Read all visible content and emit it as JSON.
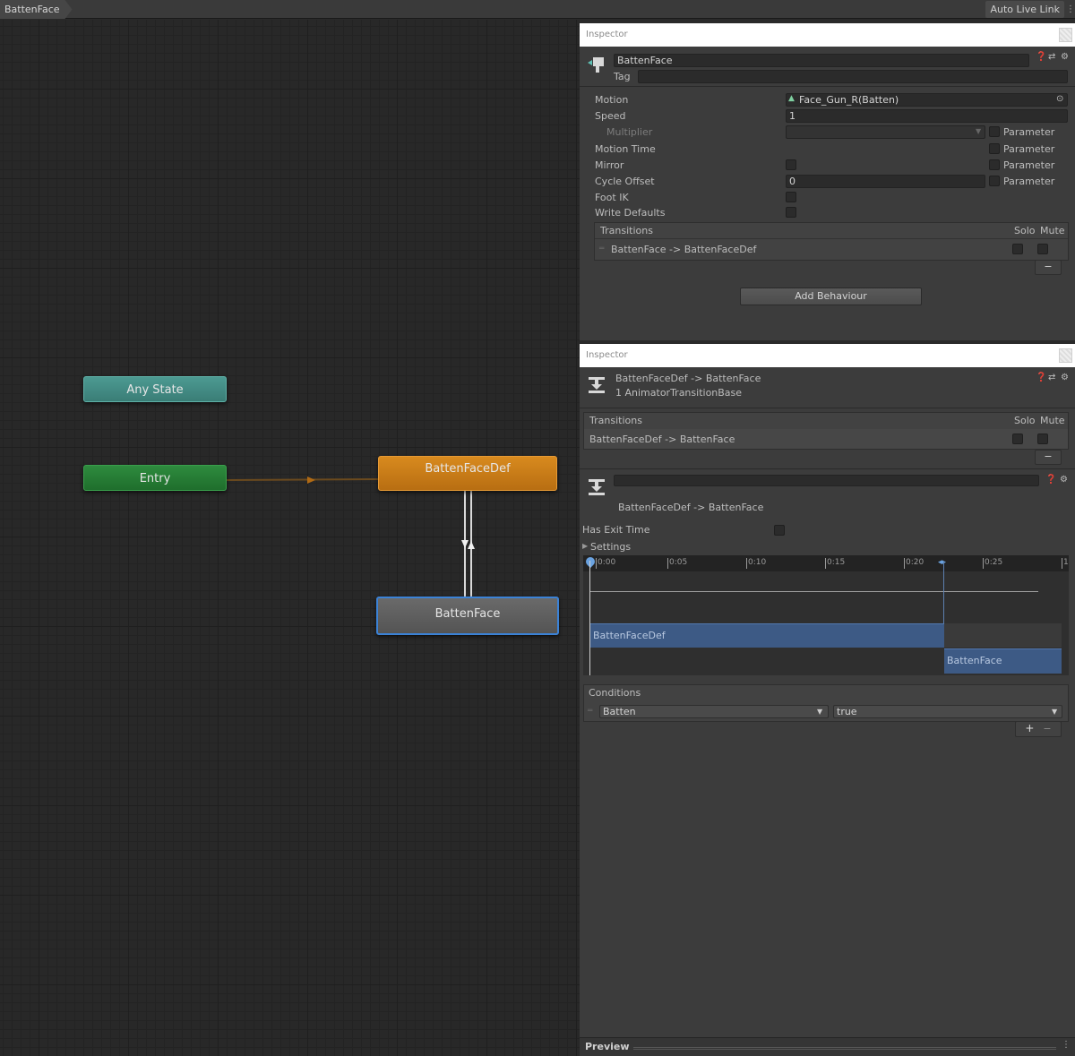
{
  "topbar": {
    "breadcrumb": "BattenFace",
    "auto_live_link": "Auto Live Link"
  },
  "graph": {
    "nodes": {
      "any_state": "Any State",
      "entry": "Entry",
      "batten_face_def": "BattenFaceDef",
      "batten_face": "BattenFace"
    }
  },
  "inspector1": {
    "title": "Inspector",
    "state_name": "BattenFace",
    "tag_label": "Tag",
    "tag_value": "",
    "motion_label": "Motion",
    "motion_value": "Face_Gun_R(Batten)",
    "speed_label": "Speed",
    "speed_value": "1",
    "multiplier_label": "Multiplier",
    "motion_time_label": "Motion Time",
    "mirror_label": "Mirror",
    "cycle_offset_label": "Cycle Offset",
    "cycle_offset_value": "0",
    "foot_ik_label": "Foot IK",
    "write_defaults_label": "Write Defaults",
    "parameter_label": "Parameter",
    "transitions_header": "Transitions",
    "solo_label": "Solo",
    "mute_label": "Mute",
    "transition_row": "BattenFace -> BattenFaceDef",
    "minus": "−",
    "add_behaviour": "Add Behaviour"
  },
  "inspector2": {
    "title": "Inspector",
    "header_title": "BattenFaceDef -> BattenFace",
    "header_subtitle": "1 AnimatorTransitionBase",
    "transitions_header": "Transitions",
    "solo_label": "Solo",
    "mute_label": "Mute",
    "transition_row": "BattenFaceDef -> BattenFace",
    "minus": "−",
    "transition_name": "BattenFaceDef -> BattenFace",
    "has_exit_time_label": "Has Exit Time",
    "settings_label": "Settings",
    "timeline": {
      "ticks": [
        "0:00",
        "0:05",
        "0:10",
        "0:15",
        "0:20",
        "0:25",
        "1"
      ],
      "bar_from": "BattenFaceDef",
      "bar_to": "BattenFace"
    },
    "conditions_header": "Conditions",
    "condition_param": "Batten",
    "condition_value": "true",
    "plus": "+",
    "preview_label": "Preview"
  },
  "colors": {
    "any_state": "#3f8a83",
    "entry": "#267d35",
    "default_state": "#c97a16",
    "selected_state_border": "#3b82d6",
    "timeline_bar": "#3d5a85"
  }
}
